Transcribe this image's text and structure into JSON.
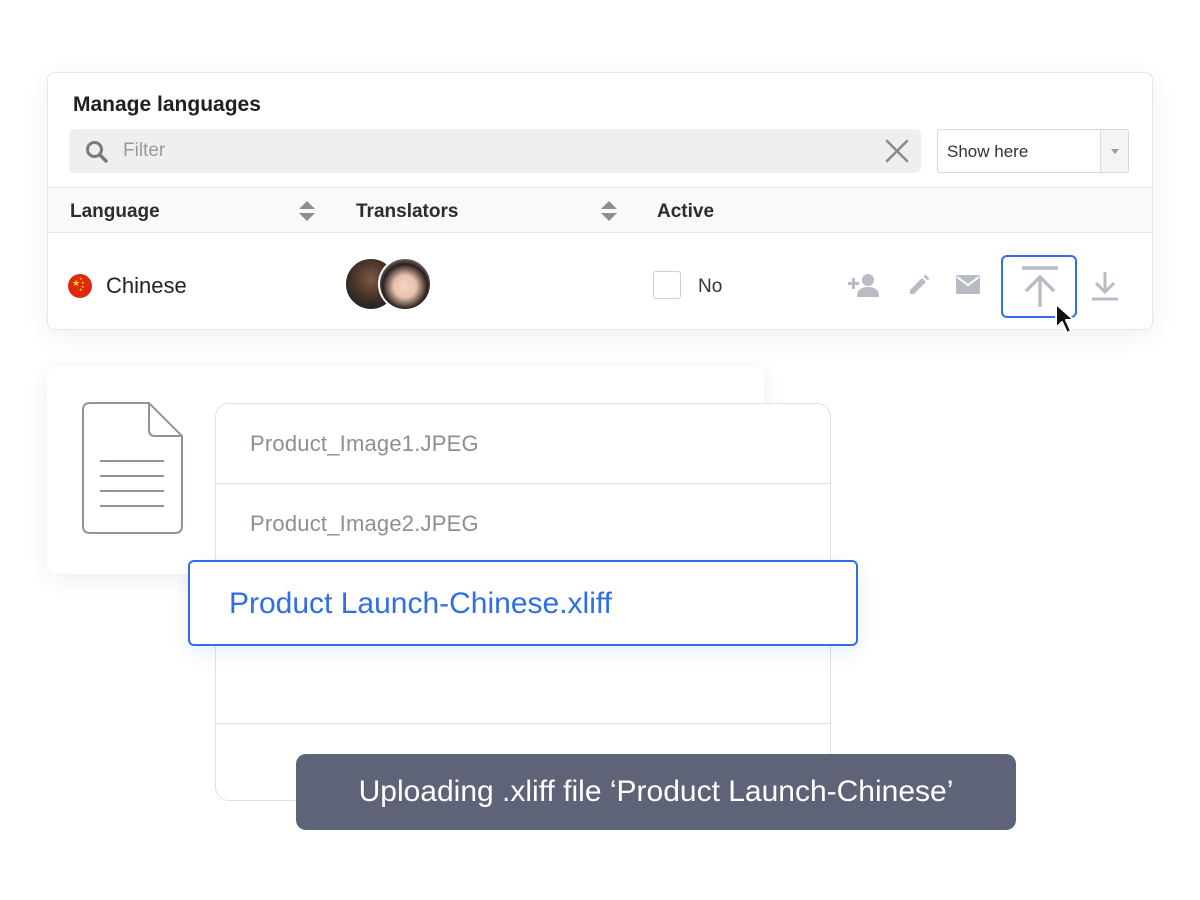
{
  "panel": {
    "title": "Manage languages",
    "filter": {
      "placeholder": "Filter",
      "value": ""
    },
    "show_select": {
      "selected": "Show here"
    }
  },
  "table": {
    "columns": [
      "Language",
      "Translators",
      "Active"
    ],
    "rows": [
      {
        "language": "Chinese",
        "flag": "china-flag",
        "translators": [
          "translator-avatar-1",
          "translator-avatar-2"
        ],
        "active_label": "No",
        "active_checked": false,
        "actions": [
          "add-person-icon",
          "pencil-icon",
          "envelope-icon",
          "upload-icon",
          "download-icon"
        ]
      }
    ]
  },
  "upload": {
    "files": [
      "Product_Image1.JPEG",
      "Product_Image2.JPEG",
      "",
      ""
    ],
    "selected_file": "Product Launch-Chinese.xliff",
    "toast": "Uploading .xliff file ‘Product Launch-Chinese’"
  },
  "colors": {
    "accent": "#2f6ee6",
    "toast_bg": "#5f6377",
    "muted_icon": "#b9bcc6",
    "flag_red": "#de2910"
  }
}
